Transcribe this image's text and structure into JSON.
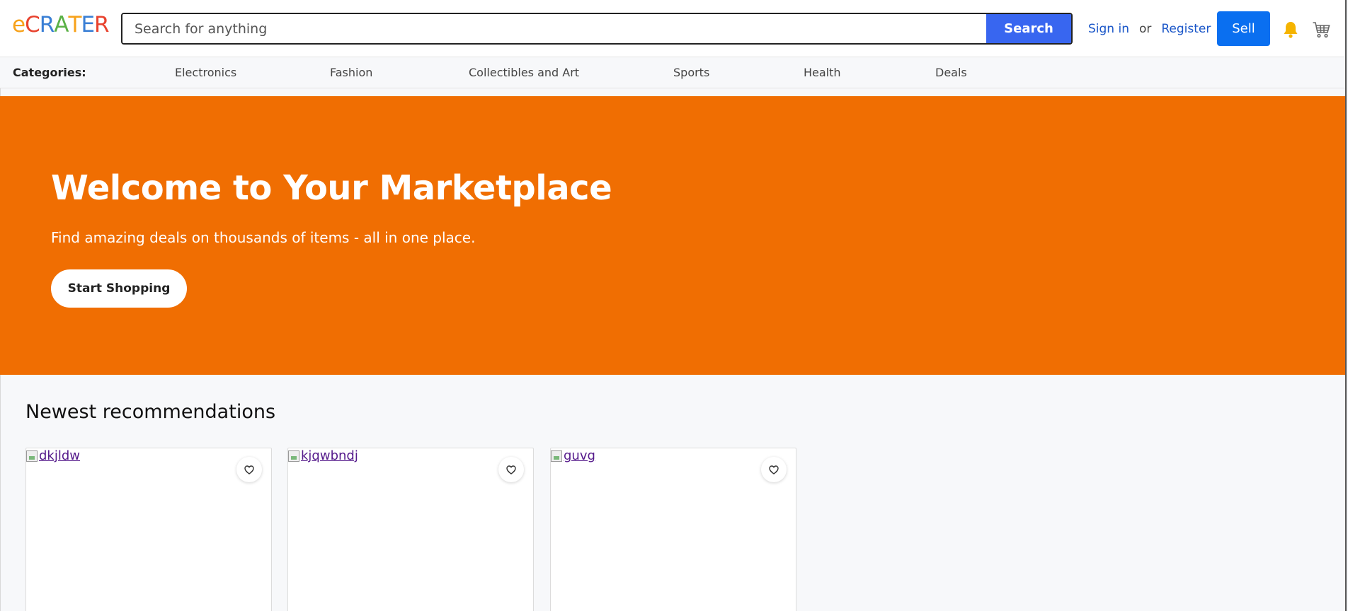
{
  "header": {
    "logo": {
      "letters": [
        {
          "char": "e",
          "color": "#f7a21b"
        },
        {
          "char": "C",
          "color": "#e8432f"
        },
        {
          "char": "R",
          "color": "#3a7fd5"
        },
        {
          "char": "A",
          "color": "#5bb147"
        },
        {
          "char": "T",
          "color": "#f7a21b"
        },
        {
          "char": "E",
          "color": "#3a7fd5"
        },
        {
          "char": "R",
          "color": "#e8432f"
        }
      ]
    },
    "search": {
      "placeholder": "Search for anything",
      "value": "",
      "button_label": "Search"
    },
    "auth": {
      "sign_in": "Sign in",
      "or": "or",
      "register": "Register"
    },
    "sell_label": "Sell",
    "icons": {
      "bell": "bell-icon",
      "cart": "cart-icon"
    }
  },
  "categories": {
    "label": "Categories:",
    "items": [
      "Electronics",
      "Fashion",
      "Collectibles and Art",
      "Sports",
      "Health",
      "Deals"
    ]
  },
  "hero": {
    "title": "Welcome to Your Marketplace",
    "subtitle": "Find amazing deals on thousands of items - all in one place.",
    "button_label": "Start Shopping",
    "background": "#f06e02"
  },
  "recommendations": {
    "title": "Newest recommendations",
    "items": [
      {
        "alt": "dkjldw"
      },
      {
        "alt": "kjqwbndj"
      },
      {
        "alt": "guvg"
      }
    ]
  },
  "colors": {
    "search_button": "#3866f0",
    "sell_button": "#0a6ff0",
    "link": "#1a56c8",
    "bell": "#f5b400"
  }
}
